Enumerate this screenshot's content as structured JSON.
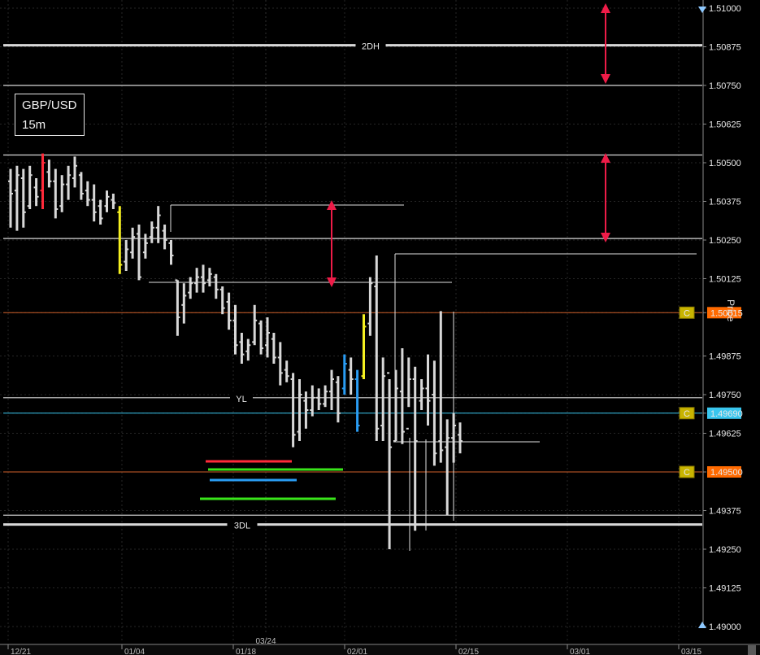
{
  "symbol": {
    "pair": "GBP/USD",
    "timeframe": "15m"
  },
  "axis": {
    "title": "Price"
  },
  "colors": {
    "background": "#000000",
    "bars": "#d8d8d8",
    "highlight_red": "#ff2a3a",
    "highlight_yellow": "#f5f020",
    "highlight_blue": "#2a9df4",
    "level_orange": "#d0602a",
    "level_cyan": "#39c6ee",
    "arrow": "#ee1c48",
    "marker_green": "#39e51a",
    "marker_red": "#ff2a3a",
    "marker_blue": "#2a9df4"
  },
  "chart_data": {
    "type": "ohlc-bars",
    "ylim": [
      1.49,
      1.51
    ],
    "y_ticks": [
      "1.51000",
      "1.50875",
      "1.50750",
      "1.50625",
      "1.50500",
      "1.50375",
      "1.50250",
      "1.50125",
      "1.50015",
      "1.49875",
      "1.49750",
      "1.49690",
      "1.49625",
      "1.49500",
      "1.49375",
      "1.49250",
      "1.49125",
      "1.49000"
    ],
    "x_ticks": [
      "12/21",
      "01/04",
      "01/18",
      "02/01",
      "02/15",
      "03/01",
      "03/15"
    ],
    "x_top_label": "03/24",
    "horizontal_levels": [
      {
        "label": "2DH",
        "price": 1.5088,
        "style": "double-white"
      },
      {
        "label": "",
        "price": 1.5075,
        "style": "white"
      },
      {
        "label": "",
        "price": 1.50525,
        "style": "white"
      },
      {
        "label": "",
        "price": 1.50255,
        "style": "white"
      },
      {
        "label": "",
        "price": 1.50015,
        "style": "orange",
        "tag": "C",
        "marker": "1.50015"
      },
      {
        "label": "YL",
        "price": 1.4974,
        "style": "white"
      },
      {
        "label": "",
        "price": 1.4969,
        "style": "cyan",
        "tag": "C",
        "marker": "1.49690"
      },
      {
        "label": "",
        "price": 1.495,
        "style": "orange",
        "tag": "C",
        "marker": "1.49500"
      },
      {
        "label": "",
        "price": 1.4936,
        "style": "white"
      },
      {
        "label": "3DL",
        "price": 1.4933,
        "style": "double-white"
      }
    ],
    "bars": [
      {
        "h": 1.5048,
        "l": 1.5029,
        "o": 1.5044,
        "c": 1.504
      },
      {
        "h": 1.5049,
        "l": 1.5028,
        "o": 1.5041,
        "c": 1.5046
      },
      {
        "h": 1.5048,
        "l": 1.5029,
        "o": 1.5045,
        "c": 1.5034
      },
      {
        "h": 1.5049,
        "l": 1.5035,
        "o": 1.5036,
        "c": 1.5046
      },
      {
        "h": 1.5045,
        "l": 1.5036,
        "o": 1.5042,
        "c": 1.5039
      },
      {
        "h": 1.5053,
        "l": 1.5035,
        "o": 1.5041,
        "c": 1.505,
        "color": "red"
      },
      {
        "h": 1.5051,
        "l": 1.5042,
        "o": 1.5047,
        "c": 1.5044
      },
      {
        "h": 1.5048,
        "l": 1.5032,
        "o": 1.5044,
        "c": 1.5035
      },
      {
        "h": 1.5046,
        "l": 1.5034,
        "o": 1.5036,
        "c": 1.5043
      },
      {
        "h": 1.5049,
        "l": 1.5038,
        "o": 1.5043,
        "c": 1.5046
      },
      {
        "h": 1.5052,
        "l": 1.5042,
        "o": 1.5045,
        "c": 1.5049
      },
      {
        "h": 1.5047,
        "l": 1.5038,
        "o": 1.5046,
        "c": 1.504
      },
      {
        "h": 1.5044,
        "l": 1.5036,
        "o": 1.5041,
        "c": 1.5038
      },
      {
        "h": 1.5043,
        "l": 1.5031,
        "o": 1.5038,
        "c": 1.5034
      },
      {
        "h": 1.5038,
        "l": 1.503,
        "o": 1.5036,
        "c": 1.5032
      },
      {
        "h": 1.5041,
        "l": 1.5034,
        "o": 1.5036,
        "c": 1.5039
      },
      {
        "h": 1.504,
        "l": 1.5035,
        "o": 1.5038,
        "c": 1.5037
      },
      {
        "h": 1.5036,
        "l": 1.5014,
        "o": 1.5034,
        "c": 1.5017,
        "color": "yellow"
      },
      {
        "h": 1.5025,
        "l": 1.5015,
        "o": 1.5018,
        "c": 1.5022
      },
      {
        "h": 1.5029,
        "l": 1.5019,
        "o": 1.5021,
        "c": 1.5026
      },
      {
        "h": 1.503,
        "l": 1.5012,
        "o": 1.5027,
        "c": 1.5013
      },
      {
        "h": 1.5027,
        "l": 1.5019,
        "o": 1.5021,
        "c": 1.5024
      },
      {
        "h": 1.5031,
        "l": 1.5024,
        "o": 1.5026,
        "c": 1.5029
      },
      {
        "h": 1.5036,
        "l": 1.5024,
        "o": 1.5029,
        "c": 1.5033
      },
      {
        "h": 1.503,
        "l": 1.5022,
        "o": 1.5028,
        "c": 1.5025
      },
      {
        "h": 1.5025,
        "l": 1.5017,
        "o": 1.5024,
        "c": 1.502
      },
      {
        "h": 1.5012,
        "l": 1.4994,
        "o": 1.5012,
        "c": 1.5
      },
      {
        "h": 1.5011,
        "l": 1.4998,
        "o": 1.5004,
        "c": 1.5007
      },
      {
        "h": 1.5013,
        "l": 1.5006,
        "o": 1.5008,
        "c": 1.5011
      },
      {
        "h": 1.5016,
        "l": 1.5008,
        "o": 1.5011,
        "c": 1.5013
      },
      {
        "h": 1.5017,
        "l": 1.5008,
        "o": 1.5013,
        "c": 1.5011
      },
      {
        "h": 1.5016,
        "l": 1.501,
        "o": 1.5012,
        "c": 1.5014
      },
      {
        "h": 1.5014,
        "l": 1.5006,
        "o": 1.5013,
        "c": 1.5009
      },
      {
        "h": 1.501,
        "l": 1.5001,
        "o": 1.5009,
        "c": 1.5003
      },
      {
        "h": 1.5008,
        "l": 1.4996,
        "o": 1.5005,
        "c": 1.4999
      },
      {
        "h": 1.5004,
        "l": 1.4988,
        "o": 1.4999,
        "c": 1.4991
      },
      {
        "h": 1.4995,
        "l": 1.4985,
        "o": 1.4992,
        "c": 1.4988
      },
      {
        "h": 1.4993,
        "l": 1.4986,
        "o": 1.4989,
        "c": 1.4991
      },
      {
        "h": 1.5004,
        "l": 1.4991,
        "o": 1.4992,
        "c": 1.4999
      },
      {
        "h": 1.4999,
        "l": 1.4988,
        "o": 1.4998,
        "c": 1.499
      },
      {
        "h": 1.5,
        "l": 1.4987,
        "o": 1.4991,
        "c": 1.4995
      },
      {
        "h": 1.4995,
        "l": 1.4985,
        "o": 1.4993,
        "c": 1.4987
      },
      {
        "h": 1.4992,
        "l": 1.4978,
        "o": 1.4987,
        "c": 1.4982
      },
      {
        "h": 1.4986,
        "l": 1.4979,
        "o": 1.4983,
        "c": 1.4981
      },
      {
        "h": 1.4982,
        "l": 1.4958,
        "o": 1.498,
        "c": 1.4962
      },
      {
        "h": 1.498,
        "l": 1.496,
        "o": 1.4963,
        "c": 1.4975
      },
      {
        "h": 1.4976,
        "l": 1.4964,
        "o": 1.4973,
        "c": 1.497
      },
      {
        "h": 1.4978,
        "l": 1.4968,
        "o": 1.497,
        "c": 1.4974
      },
      {
        "h": 1.4977,
        "l": 1.497,
        "o": 1.4974,
        "c": 1.4972
      },
      {
        "h": 1.4978,
        "l": 1.4971,
        "o": 1.4972,
        "c": 1.4976
      },
      {
        "h": 1.4983,
        "l": 1.497,
        "o": 1.4976,
        "c": 1.498
      },
      {
        "h": 1.4981,
        "l": 1.4966,
        "o": 1.4979,
        "c": 1.4969
      },
      {
        "h": 1.4988,
        "l": 1.4975,
        "o": 1.4977,
        "c": 1.4985,
        "color": "blue"
      },
      {
        "h": 1.4987,
        "l": 1.4975,
        "o": 1.4983,
        "c": 1.498
      },
      {
        "h": 1.4983,
        "l": 1.4963,
        "o": 1.498,
        "c": 1.4965,
        "color": "blue"
      },
      {
        "h": 1.5001,
        "l": 1.498,
        "o": 1.4981,
        "c": 1.4997,
        "color": "yellow"
      },
      {
        "h": 1.5013,
        "l": 1.4994,
        "o": 1.4998,
        "c": 1.5011
      },
      {
        "h": 1.502,
        "l": 1.496,
        "o": 1.501,
        "c": 1.4964
      },
      {
        "h": 1.4987,
        "l": 1.496,
        "o": 1.4965,
        "c": 1.4981
      },
      {
        "h": 1.498,
        "l": 1.4925,
        "o": 1.4982,
        "c": 1.4958
      },
      {
        "h": 1.4983,
        "l": 1.496,
        "o": 1.496,
        "c": 1.4977
      },
      {
        "h": 1.499,
        "l": 1.4959,
        "o": 1.4976,
        "c": 1.4963
      },
      {
        "h": 1.4987,
        "l": 1.4971,
        "o": 1.4964,
        "c": 1.498
      },
      {
        "h": 1.4984,
        "l": 1.4931,
        "o": 1.498,
        "c": 1.496
      },
      {
        "h": 1.498,
        "l": 1.497,
        "o": 1.4973,
        "c": 1.4977
      },
      {
        "h": 1.4988,
        "l": 1.4965,
        "o": 1.4977,
        "c": 1.4973
      },
      {
        "h": 1.4986,
        "l": 1.4952,
        "o": 1.4975,
        "c": 1.4956
      },
      {
        "h": 1.5002,
        "l": 1.4953,
        "o": 1.496,
        "c": 1.4957
      },
      {
        "h": 1.4967,
        "l": 1.4936,
        "o": 1.4958,
        "c": 1.4961
      },
      {
        "h": 1.4969,
        "l": 1.4953,
        "o": 1.4961,
        "c": 1.4965
      },
      {
        "h": 1.4966,
        "l": 1.4956,
        "o": 1.4962,
        "c": 1.496
      }
    ]
  }
}
